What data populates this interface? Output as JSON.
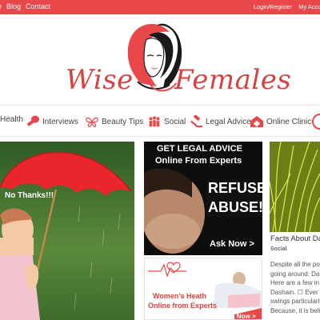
{
  "topbar": {
    "nav": [
      "e",
      "Blog",
      "Contact"
    ],
    "login": "Login/Register",
    "account": "My Account"
  },
  "logo": {
    "word1": "Wise",
    "word2": "Females"
  },
  "categories": [
    {
      "label": "Health",
      "icon": "health-icon"
    },
    {
      "label": "Interviews",
      "icon": "microphone-icon"
    },
    {
      "label": "Beauty Tips",
      "icon": "butterfly-icon"
    },
    {
      "label": "Social",
      "icon": "people-icon"
    },
    {
      "label": "Legal Advice",
      "icon": "gavel-icon"
    },
    {
      "label": "Online Clinic",
      "icon": "clinic-icon"
    }
  ],
  "hero": {
    "caption": "No Thanks!!!"
  },
  "legal_ad": {
    "line1": "GET LEGAL ADVICE",
    "line2": "Online From Experts",
    "refuse": "REFUSE",
    "abuse": "ABUSE!",
    "cta": "Ask Now >"
  },
  "health_ad": {
    "line1": "Women's Heath",
    "line2": "Online from Experts",
    "cta": "Ask Now >"
  },
  "side_post": {
    "title": "Facts About Da",
    "category": "Social",
    "excerpt": [
      "Despite all the po",
      "going around: Da",
      "Here are a few in",
      "Dashain. ☐ Ever w",
      "swings particularl",
      "Because, it is belie"
    ]
  },
  "colors": {
    "brand": "#e8484a",
    "logo_red": "#d9433f"
  }
}
